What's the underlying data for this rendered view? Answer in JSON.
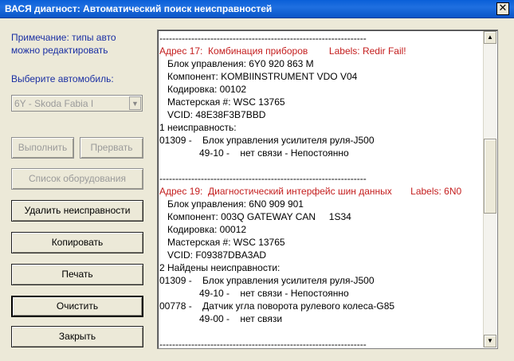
{
  "window": {
    "title": "ВАСЯ диагност: Автоматический поиск неисправностей",
    "close_symbol": "✕"
  },
  "left_panel": {
    "note_line1": "Примечание: типы авто",
    "note_line2": "можно редактировать",
    "select_label": "Выберите автомобиль:",
    "select_value": "6Y - Skoda Fabia I",
    "buttons": {
      "execute": "Выполнить",
      "abort": "Прервать",
      "equipment_list": "Список оборудования",
      "delete_faults": "Удалить неисправности",
      "copy": "Копировать",
      "print": "Печать",
      "clear": "Очистить",
      "close": "Закрыть"
    }
  },
  "log": {
    "lines": [
      "-----------------------------------------------------------------",
      "Адрес 17:  Комбинация приборов        Labels: Redir Fail!",
      "   Блок управления: 6Y0 920 863 M",
      "   Компонент: KOMBIINSTRUMENT VDO V04",
      "   Кодировка: 00102",
      "   Мастерская #: WSC 13765",
      "   VCID: 48E38F3B7BBD",
      "1 неисправность:",
      "01309 -    Блок управления усилителя руля-J500",
      "               49-10 -    нет связи - Непостоянно",
      "",
      "-----------------------------------------------------------------",
      "Адрес 19:  Диагностический интерфейс шин данных       Labels: 6N0",
      "   Блок управления: 6N0 909 901",
      "   Компонент: 003Q GATEWAY CAN     1S34",
      "   Кодировка: 00012",
      "   Мастерская #: WSC 13765",
      "   VCID: F09387DBA3AD",
      "2 Найдены неисправности:",
      "01309 -    Блок управления усилителя руля-J500",
      "               49-10 -    нет связи - Непостоянно",
      "00778 -    Датчик угла поворота рулевого колеса-G85",
      "               49-00 -    нет связи",
      "",
      "-----------------------------------------------------------------"
    ],
    "red_line_indices": [
      1,
      12
    ],
    "scroll_position": 0.44
  },
  "colors": {
    "title_bar": "#0a5fd8",
    "window_bg": "#ece9d8",
    "label_blue": "#1a2fa3",
    "address_red": "#c41e1e"
  },
  "icons": {
    "close": "close-icon",
    "scroll_up": "scroll-up-arrow-icon",
    "scroll_down": "scroll-down-arrow-icon",
    "dropdown": "chevron-down-icon"
  }
}
